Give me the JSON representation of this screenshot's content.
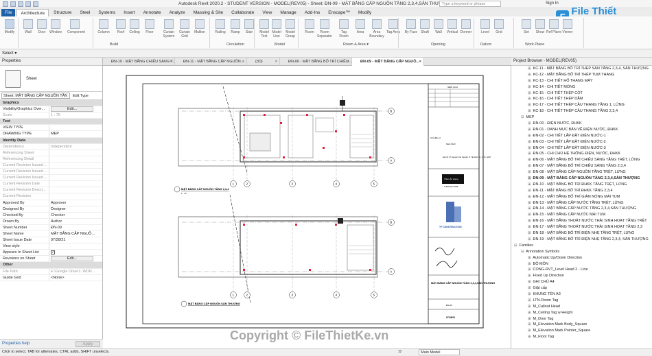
{
  "app": {
    "window_title": "Autodesk Revit 2020.2 - STUDENT VERSION - MODEL(REV05) - Sheet: ĐN-09 - MẶT BẰNG CẤP NGUỒN TẦNG 2,3,4,SÂN THƯỢNG",
    "search_placeholder": "Type a keyword or phrase",
    "sign_in": "Sign In",
    "logo_text": "File Thiết Kế.vn",
    "logo_mark": "F"
  },
  "ribbon_tabs": [
    "File",
    "Architecture",
    "Structure",
    "Steel",
    "Systems",
    "Insert",
    "Annotate",
    "Analyze",
    "Massing & Site",
    "Collaborate",
    "View",
    "Manage",
    "Add-Ins",
    "Enscape™",
    "Modify"
  ],
  "ribbon_buttons": [
    "Modify",
    "Wall",
    "Door",
    "Window",
    "Component",
    "Column",
    "Roof",
    "Ceiling",
    "Floor",
    "Curtain System",
    "Curtain Grid",
    "Mullion",
    "Railing",
    "Ramp",
    "Stair",
    "Model Text",
    "Model Line",
    "Model Group",
    "Room",
    "Room Separator",
    "Tag Room",
    "Area",
    "Area Boundary",
    "Tag Area",
    "By Face",
    "Shaft",
    "Wall",
    "Vertical",
    "Dormer",
    "Level",
    "Grid",
    "Set",
    "Show",
    "Ref Plane",
    "Viewer"
  ],
  "ribbon_groups": [
    "Select ▾",
    "Build",
    "Circulation",
    "Model",
    "Room & Area ▾",
    "Opening",
    "Datum",
    "Work Plane"
  ],
  "properties": {
    "title": "Properties",
    "family": "Sheet",
    "type_selector": "Sheet: MẶT BẰNG CẤP NGUỒN TẦN",
    "edit_type": "Edit Type",
    "rows": [
      {
        "k": "Graphics",
        "v": "",
        "sec": true
      },
      {
        "k": "Visibility/Graphics Over...",
        "v": "Edit...",
        "btn": true
      },
      {
        "k": "Scale",
        "v": "1 : 75",
        "grey": true
      },
      {
        "k": "Text",
        "v": "",
        "sec": true
      },
      {
        "k": "VIEW TYPE",
        "v": ""
      },
      {
        "k": "DRAWING TYPE",
        "v": "MEP"
      },
      {
        "k": "Identity Data",
        "v": "",
        "sec": true
      },
      {
        "k": "Dependency",
        "v": "Independent",
        "grey": true
      },
      {
        "k": "Referencing Sheet",
        "v": "",
        "grey": true
      },
      {
        "k": "Referencing Detail",
        "v": "",
        "grey": true
      },
      {
        "k": "Current Revision Issued ...",
        "v": "",
        "grey": true
      },
      {
        "k": "Current Revision Issued ...",
        "v": "",
        "grey": true
      },
      {
        "k": "Current Revision Issued ...",
        "v": "",
        "grey": true
      },
      {
        "k": "Current Revision Date",
        "v": "",
        "grey": true
      },
      {
        "k": "Current Revision Descri...",
        "v": "",
        "grey": true
      },
      {
        "k": "Current Revision",
        "v": "",
        "grey": true
      },
      {
        "k": "Approved By",
        "v": "Approver"
      },
      {
        "k": "Designed By",
        "v": "Designer"
      },
      {
        "k": "Checked By",
        "v": "Checker"
      },
      {
        "k": "Drawn By",
        "v": "Author"
      },
      {
        "k": "Sheet Number",
        "v": "ĐN-09"
      },
      {
        "k": "Sheet Name",
        "v": "MẶT BẰNG CẤP NGUỒ..."
      },
      {
        "k": "Sheet Issue Date",
        "v": "07/28/21"
      },
      {
        "k": "View style",
        "v": ""
      },
      {
        "k": "Appears In Sheet List",
        "v": "",
        "chk": true
      },
      {
        "k": "Revisions on Sheet",
        "v": "Edit...",
        "btn": true
      },
      {
        "k": "Other",
        "v": "",
        "sec": true
      },
      {
        "k": "File Path",
        "v": "E:\\Google Drive\\1. WOR...",
        "grey": true
      },
      {
        "k": "Guide Grid",
        "v": "<None>"
      }
    ],
    "help_link": "Properties help",
    "apply": "Apply"
  },
  "view_tabs": [
    {
      "label": "ĐN-10 - MẶT BẰNG CHIẾU SÁNG T..."
    },
    {
      "label": "ĐN-11 - MẶT BẰNG CẤP NGUỒN..."
    },
    {
      "label": "{3D}",
      "small": true
    },
    {
      "label": "ĐN-06 - MẶT BẰNG BỐ TRÍ CHIẾU..."
    },
    {
      "label": "ĐN-09 - MẶT BẰNG CẤP NGUỒ...",
      "active": true
    }
  ],
  "drawing": {
    "plan1_title": "MẶT BẰNG CẤP NGUỒN TẦNG 2,3,4",
    "plan1_scale": "1 : 75",
    "plan2_title": "MẶT BẰNG CẤP NGUỒN SÂN THƯỢNG",
    "grid_numbers": [
      "1",
      "2",
      "3",
      "4",
      "5"
    ],
    "grid_letters": [
      "B",
      "A"
    ],
    "tb_revision": "NIÊN LỊCH",
    "tb_company_label": "Chủ đầu tư:",
    "tb_owner": "NHÀ PHỐ",
    "tb_address": "Địa chỉ: 27 Nguyễn Văn Nguyễn, P. Tân Định, Q. 1, Tp. HCM",
    "tb_brand": "Thiên Ấn Home",
    "tb_brand_caption": "THIEN AN HOME",
    "tb_contractor": "TP CONSTRUCTION",
    "tb_sheet_title": "MẶT BẰNG CẤP NGUỒN TẦNG 2,3,4,SÂN THƯỢNG",
    "tb_sheet_no": "ĐN-09",
    "tb_date": "07/28/21"
  },
  "browser": {
    "title": "Project Browser - MODEL(REV05)",
    "items": [
      {
        "t": "KC-11 - MẶT BẰNG BỐ TRÍ THÉP SÀN TẦNG 2,3,4, SÂN THƯỢNG",
        "i": 2
      },
      {
        "t": "KC-12 - MẶT BẰNG BỐ TRÍ THÉP TUM THANG",
        "i": 2
      },
      {
        "t": "KC-13 - CHI TIẾT HỐ THANG MÁY",
        "i": 2
      },
      {
        "t": "KC-14 - CHI TIẾT MÓNG",
        "i": 2
      },
      {
        "t": "KC-15 - CHI TIẾT THÉP CỘT",
        "i": 2
      },
      {
        "t": "KC-16 - CHI TIẾT THÉP DẦM",
        "i": 2
      },
      {
        "t": "KC-17 - CHI TIẾT THÉP CẦU THANG TẦNG 1, LỬNG",
        "i": 2
      },
      {
        "t": "KC-18 - CHI TIẾT THÉP CẦU THANG TẦNG 2,3,4",
        "i": 2
      },
      {
        "t": "MEP",
        "i": 1,
        "tw": "⊟"
      },
      {
        "t": "ĐN-00 - ĐIỆN NƯỚC, ĐHKK",
        "i": 2
      },
      {
        "t": "ĐN-01 - DANH MỤC BẢN VẼ ĐIỆN NƯỚC, ĐHKK",
        "i": 2
      },
      {
        "t": "ĐN-02 - CHI TIẾT LẮP ĐẶT ĐIỆN NƯỚC-1",
        "i": 2
      },
      {
        "t": "ĐN-03 - CHI TIẾT LẮP ĐẶT ĐIỆN NƯỚC-2",
        "i": 2
      },
      {
        "t": "ĐN-04 - CHI TIẾT LẮP ĐẶT ĐIỆN NƯỚC-3",
        "i": 2
      },
      {
        "t": "ĐN-05 - CHI CHÚ HỆ THỐNG ĐIỆN, NƯỚC, ĐHKK",
        "i": 2
      },
      {
        "t": "ĐN-06 - MẶT BẰNG BỐ TRÍ CHIẾU SÁNG TẦNG TRỆT, LỬNG",
        "i": 2
      },
      {
        "t": "ĐN-07 - MẶT BẰNG BỐ TRÍ CHIẾU SÁNG TẦNG 2,3,4",
        "i": 2
      },
      {
        "t": "ĐN-08 - MẶT BẰNG CẤP NGUỒN TẦNG TRỆT, LỬNG",
        "i": 2
      },
      {
        "t": "ĐN-09 - MẶT BẰNG CẤP NGUỒN TẦNG 2,3,4,SÂN THƯỢNG",
        "i": 2,
        "bold": true
      },
      {
        "t": "ĐN-10 - MẶT BẰNG BỐ TRÍ ĐHKK TẦNG TRỆT, LỬNG",
        "i": 2
      },
      {
        "t": "ĐN-11 - MẶT BẰNG BỐ TRÍ ĐHKK TẦNG 2,3,4",
        "i": 2
      },
      {
        "t": "ĐN-12 - MẶT BẰNG BỐ TRÍ GIÀN NÓNG MÁI TUM",
        "i": 2
      },
      {
        "t": "ĐN-13 - MẶT BẰNG CẤP NƯỚC TẦNG TRỆT, LỬNG",
        "i": 2
      },
      {
        "t": "ĐN-14 - MẶT BẰNG CẤP NƯỚC TẦNG 2,3,4,SÂN THƯỢNG",
        "i": 2
      },
      {
        "t": "ĐN-15 - MẶT BẰNG CẤP NƯỚC MÁI TUM",
        "i": 2
      },
      {
        "t": "ĐN-16 - MẶT BẰNG THOÁT NƯỚC THẢI SINH HOẠT TẦNG TRỆT",
        "i": 2
      },
      {
        "t": "ĐN-17 - MẶT BẰNG THOÁT NƯỚC THẢI SINH HOẠT TẦNG 2,3",
        "i": 2
      },
      {
        "t": "ĐN-18 - MẶT BẰNG BỐ TRÍ ĐIỆN NHẸ TẦNG TRỆT, LỬNG",
        "i": 2
      },
      {
        "t": "ĐN-19 - MẶT BẰNG BỐ TRÍ ĐIỆN NHẸ TẦNG 2,3,4, SÂN THƯỢNG",
        "i": 2
      },
      {
        "t": "Families",
        "i": 0,
        "tw": "⊟"
      },
      {
        "t": "Annotation Symbols",
        "i": 1,
        "tw": "⊟"
      },
      {
        "t": "Automatic Up/Down Direction",
        "i": 2
      },
      {
        "t": "BỘ MÔN",
        "i": 2
      },
      {
        "t": "CONG-RVT_Level Head 2 - Line",
        "i": 2
      },
      {
        "t": "Fixed Up Direction",
        "i": 2
      },
      {
        "t": "GHI CHÚ A4",
        "i": 2
      },
      {
        "t": "Giật cấp",
        "i": 2
      },
      {
        "t": "KHUNG TÊN A3",
        "i": 2
      },
      {
        "t": "LTN-Room Tag",
        "i": 2
      },
      {
        "t": "M_Callout Head",
        "i": 2
      },
      {
        "t": "M_Ceiling Tag w Height",
        "i": 2
      },
      {
        "t": "M_Door Tag",
        "i": 2
      },
      {
        "t": "M_Elevation Mark Body_Square",
        "i": 2
      },
      {
        "t": "M_Elevation Mark Pointer_Square",
        "i": 2
      },
      {
        "t": "M_Floor Tag",
        "i": 2
      }
    ]
  },
  "status": {
    "message": "Click to select, TAB for alternates, CTRL adds, SHIFT unselects.",
    "coord": ":0",
    "model": "Main Model"
  },
  "watermark": "Copyright © FileThietKe.vn"
}
